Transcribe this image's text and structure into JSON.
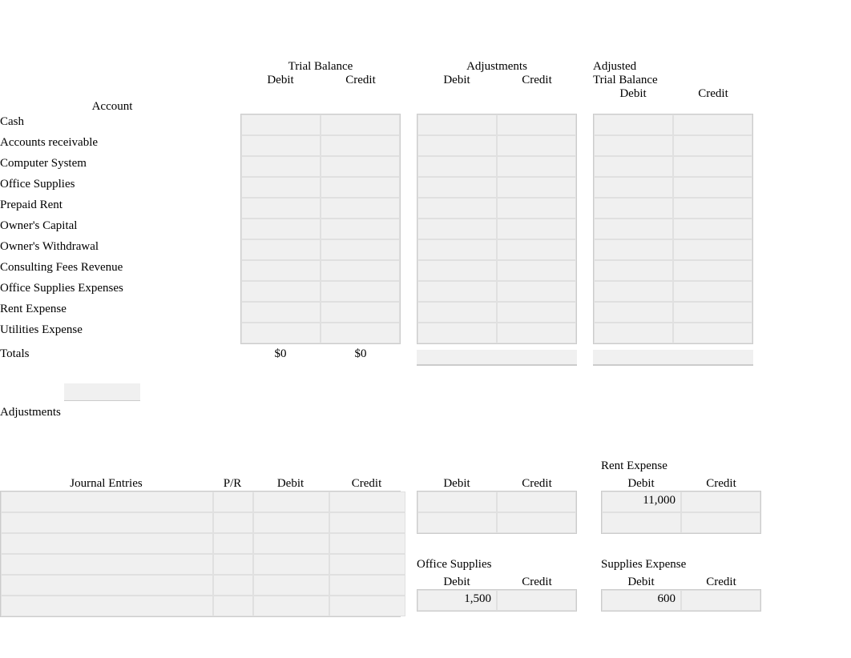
{
  "headers": {
    "account": "Account",
    "trial_balance": "Trial Balance",
    "adjustments": "Adjustments",
    "adjusted": "Adjusted",
    "adjusted_trial_balance": "Trial Balance",
    "debit": "Debit",
    "credit": "Credit",
    "totals": "Totals",
    "journal_entries": "Journal Entries",
    "pr": "P/R"
  },
  "accounts": [
    "Cash",
    "Accounts receivable",
    "Computer System",
    "Office Supplies",
    "Prepaid Rent",
    "Owner's Capital",
    "Owner's Withdrawal",
    "Consulting Fees Revenue",
    "Office Supplies Expenses",
    "Rent Expense",
    "Utilities Expense"
  ],
  "totals": {
    "tb_debit": "$0",
    "tb_credit": "$0"
  },
  "adjustments_label": "Adjustments",
  "t_accounts": {
    "rent_expense": {
      "title": "Rent Expense",
      "rows": [
        {
          "debit": "11,000",
          "credit": ""
        },
        {
          "debit": "",
          "credit": ""
        }
      ]
    },
    "office_supplies": {
      "title": "Office Supplies",
      "rows": [
        {
          "debit": "1,500",
          "credit": ""
        }
      ]
    },
    "supplies_expense": {
      "title": "Supplies Expense",
      "rows": [
        {
          "debit": "600",
          "credit": ""
        }
      ]
    },
    "unnamed": {
      "title": "",
      "rows": [
        {
          "debit": "",
          "credit": ""
        },
        {
          "debit": "",
          "credit": ""
        }
      ]
    }
  }
}
